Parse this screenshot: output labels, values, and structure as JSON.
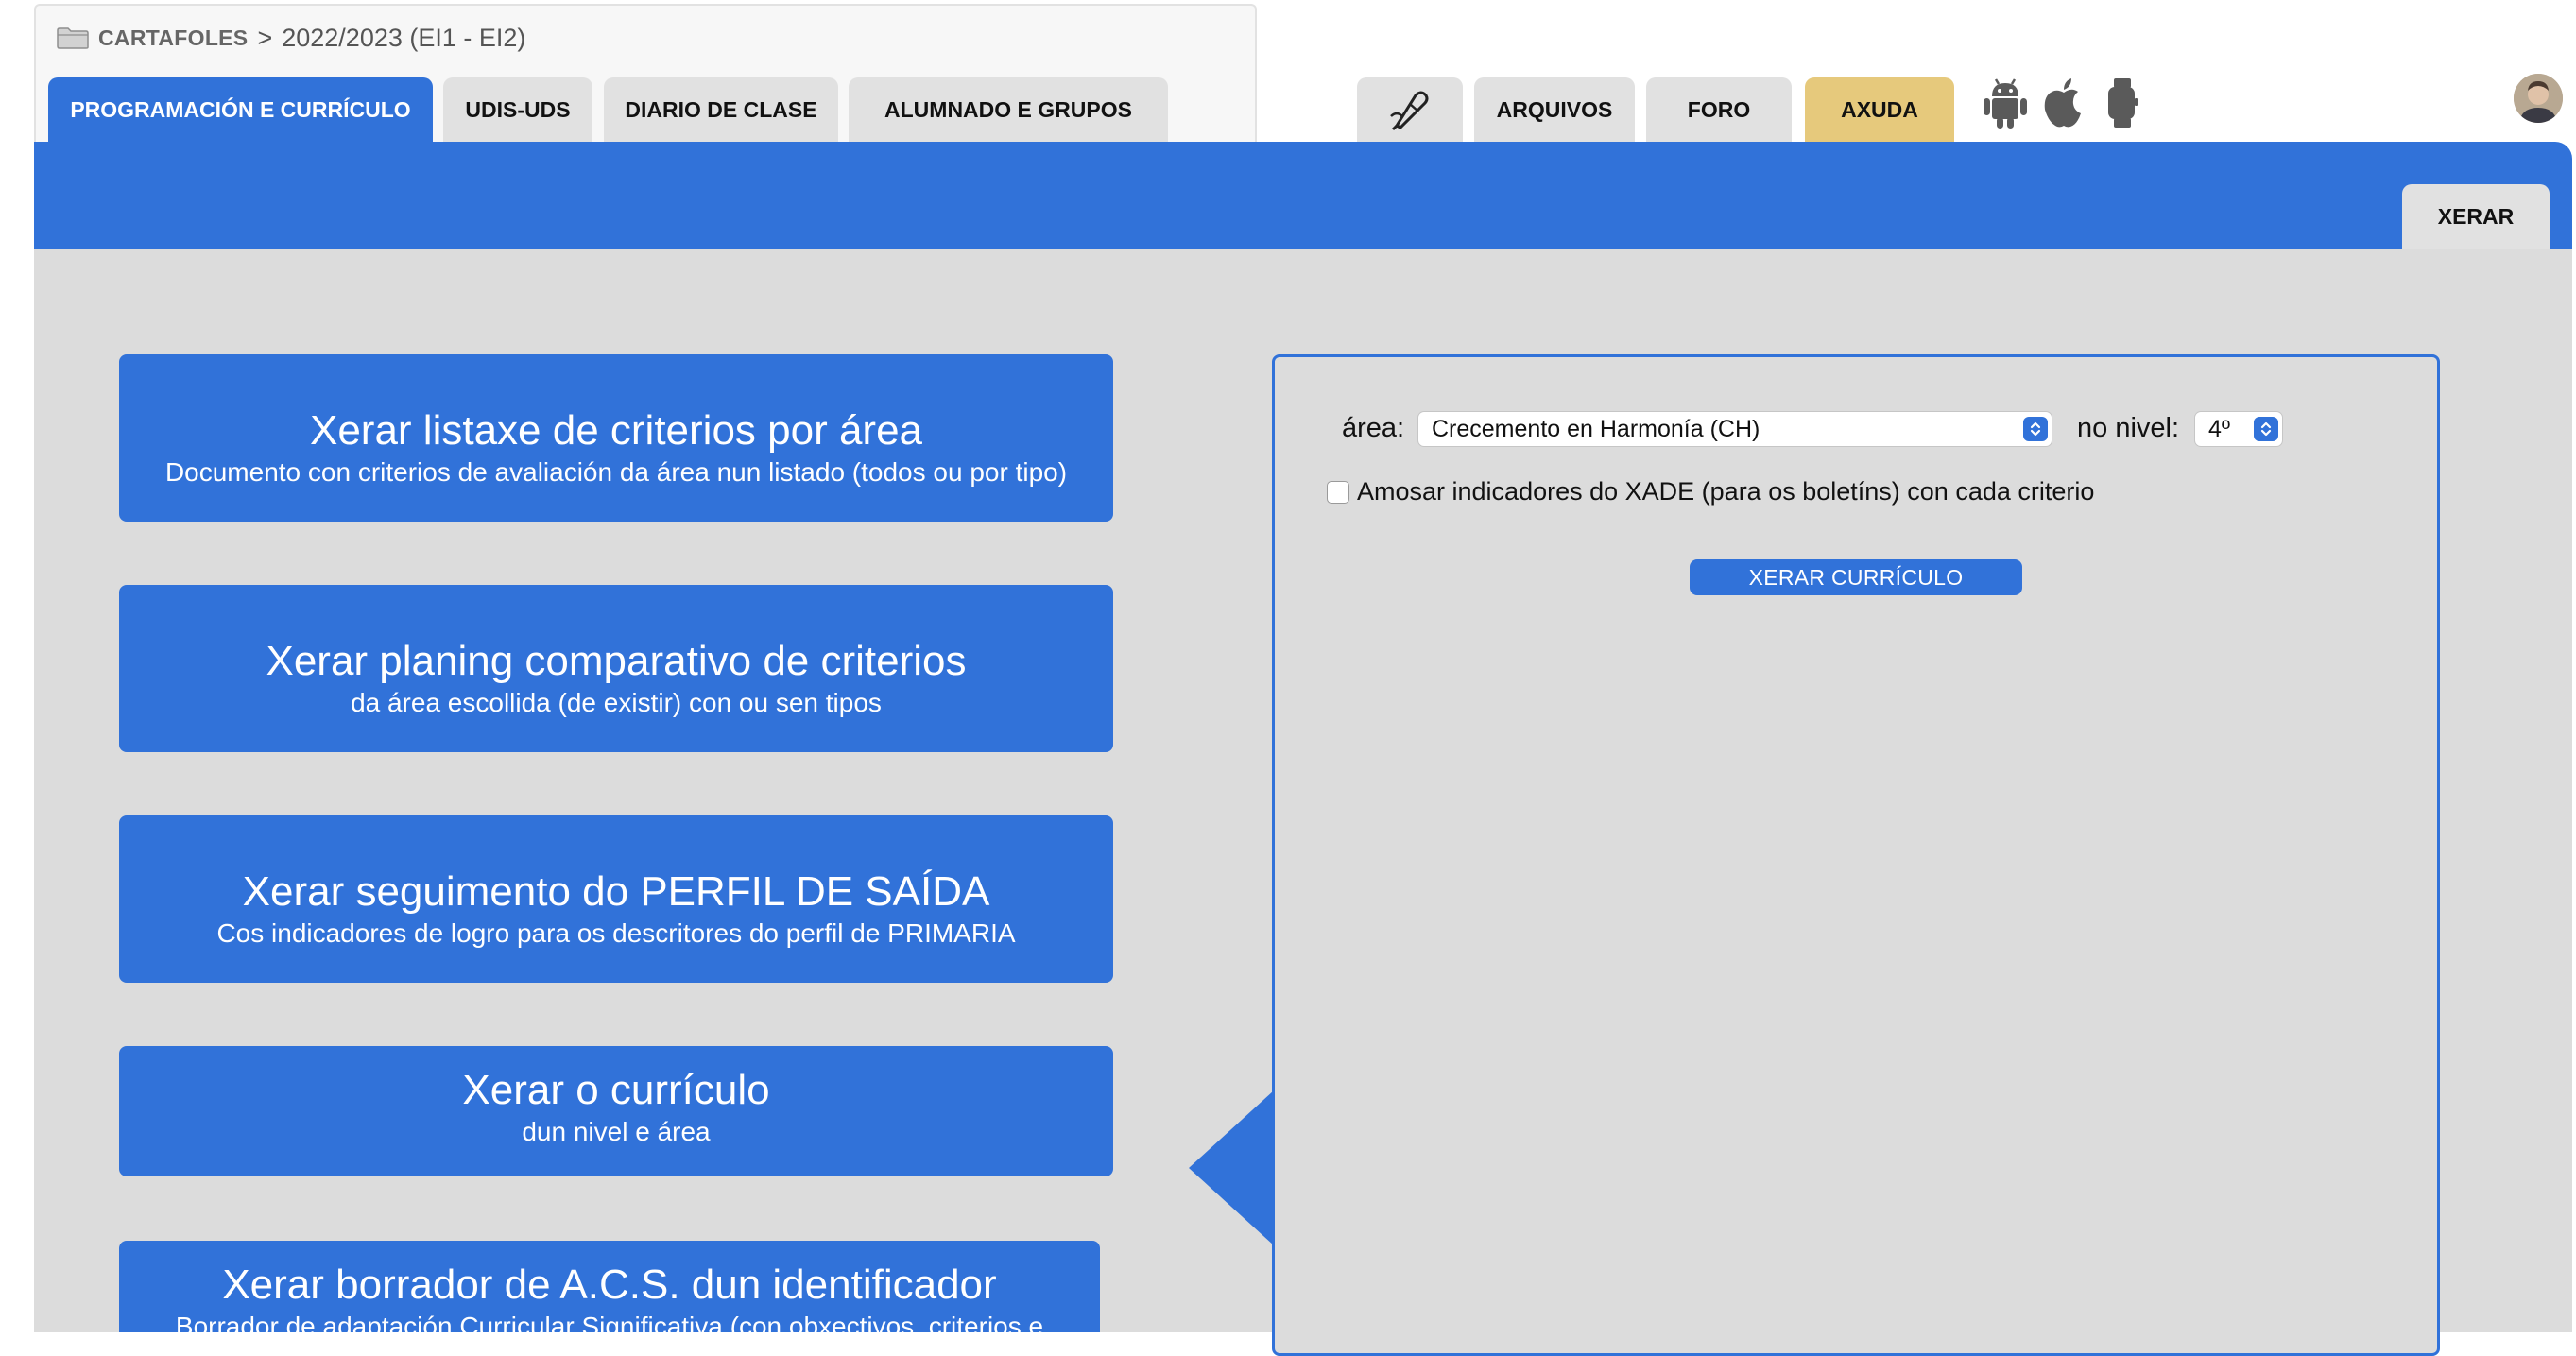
{
  "breadcrumb": {
    "root": "CARTAFOLES",
    "separator": ">",
    "path": "2022/2023 (EI1 - EI2)"
  },
  "tabs_left": [
    {
      "label": "PROGRAMACIÓN E CURRÍCULO",
      "active": true
    },
    {
      "label": "UDIS-UDS"
    },
    {
      "label": "DIARIO DE CLASE"
    },
    {
      "label": "ALUMNADO E GRUPOS"
    }
  ],
  "tabs_right": {
    "tools_icon": "pen-tool-icon",
    "files": "ARQUIVOS",
    "forum": "FORO",
    "help": "AXUDA"
  },
  "platform_icons": [
    "android-icon",
    "apple-icon",
    "watch-icon"
  ],
  "banner": {
    "tab": "XERAR"
  },
  "cards": [
    {
      "title": "Xerar listaxe de criterios por área",
      "subtitle": "Documento con criterios de avaliación da área nun listado (todos ou por tipo)"
    },
    {
      "title": "Xerar planing comparativo de criterios",
      "subtitle": "da área escollida (de existir) con ou sen tipos"
    },
    {
      "title": "Xerar seguimento do PERFIL DE SAÍDA",
      "subtitle": "Cos indicadores de logro para os descritores do perfil de PRIMARIA"
    },
    {
      "title": "Xerar o currículo",
      "subtitle": "dun nivel e área"
    },
    {
      "title": "Xerar borrador de A.C.S. dun identificador",
      "subtitle": "Borrador de adaptación Curricular Significativa (con obxectivos, criterios e"
    }
  ],
  "form": {
    "area_label": "área:",
    "area_value": "Crecemento en Harmonía (CH)",
    "level_label": "no nivel:",
    "level_value": "4º",
    "checkbox_label": "Amosar indicadores do XADE (para os boletíns) con cada criterio",
    "checkbox_checked": false,
    "submit": "XERAR CURRÍCULO"
  },
  "colors": {
    "primary": "#3172d9",
    "help_tab": "#e6c97c",
    "content_bg": "#dcdcdc",
    "tab_bg": "#e1e1e1"
  }
}
